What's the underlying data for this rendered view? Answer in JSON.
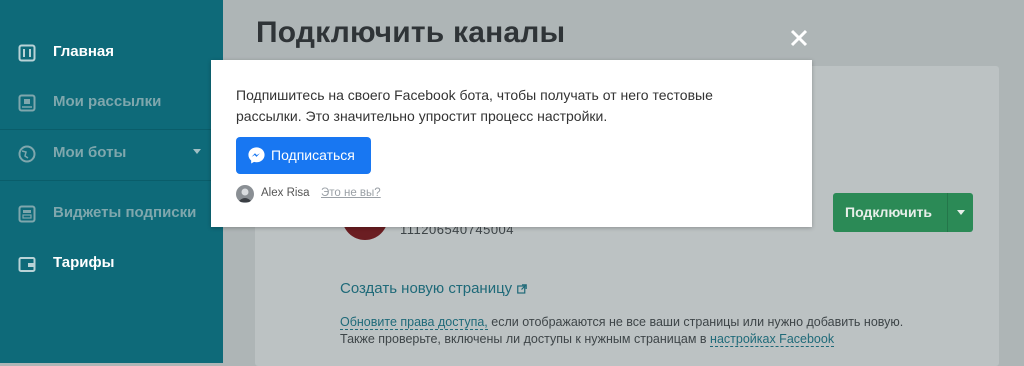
{
  "sidebar": {
    "items": [
      {
        "label": "Главная",
        "icon": "dashboard-icon",
        "active": true
      },
      {
        "label": "Мои рассылки",
        "icon": "newsletter-icon",
        "active": false
      },
      {
        "label": "Мои боты",
        "icon": "globe-icon",
        "active": false
      },
      {
        "label": "Виджеты подписки",
        "icon": "widget-icon",
        "active": false
      },
      {
        "label": "Тарифы",
        "icon": "wallet-icon",
        "active": true
      }
    ]
  },
  "main": {
    "title": "Подключить каналы",
    "page_id": "111206540745004",
    "connect_label": "Подключить",
    "create_page_link": "Создать новую страницу",
    "help": {
      "update_link": "Обновите права доступа,",
      "line1_rest": " если отображаются не все ваши страницы или нужно добавить новую.",
      "line2_start": "Также проверьте, включены ли доступы к нужным страницам в ",
      "settings_link": "настройках Facebook"
    }
  },
  "popup": {
    "text": "Подпишитесь на своего Facebook бота, чтобы получать от него тестовые рассылки. Это значительно упростит процесс настройки.",
    "button_label": "Подписаться",
    "user_name": "Alex Risa",
    "not_you": "Это не вы?"
  },
  "colors": {
    "sidebar_bg": "#0e6a79",
    "connect_green": "#2b8a56",
    "messenger_blue": "#1877f2",
    "link": "#1f6a79"
  }
}
